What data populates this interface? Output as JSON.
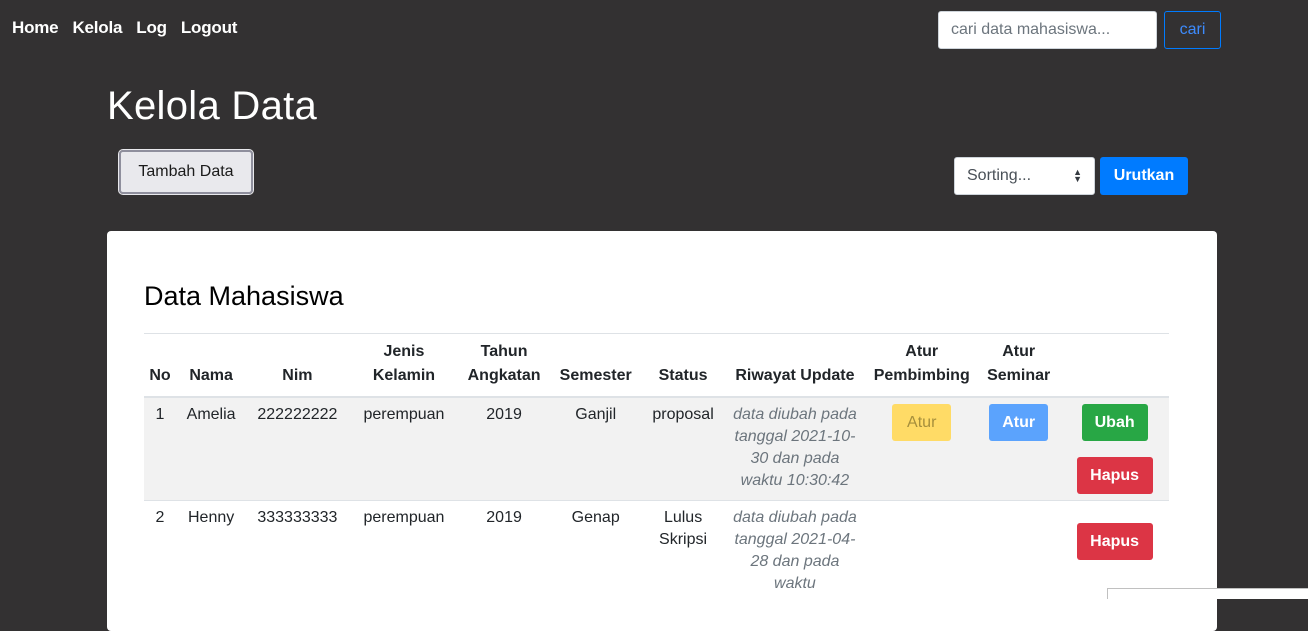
{
  "nav": {
    "items": [
      "Home",
      "Kelola",
      "Log",
      "Logout"
    ]
  },
  "search": {
    "placeholder": "cari data mahasiswa...",
    "button_label": "cari"
  },
  "page": {
    "title": "Kelola Data",
    "add_button": "Tambah Data"
  },
  "sort": {
    "selected": "Sorting...",
    "button_label": "Urutkan"
  },
  "card": {
    "title": "Data Mahasiswa"
  },
  "table": {
    "headers": [
      "No",
      "Nama",
      "Nim",
      "Jenis Kelamin",
      "Tahun Angkatan",
      "Semester",
      "Status",
      "Riwayat Update",
      "Atur Pembimbing",
      "Atur Seminar",
      ""
    ],
    "rows": [
      {
        "no": "1",
        "nama": "Amelia",
        "nim": "222222222",
        "jenis_kelamin": "perempuan",
        "tahun_angkatan": "2019",
        "semester": "Ganjil",
        "status": "proposal",
        "riwayat": "data diubah pada tanggal 2021-10-30 dan pada waktu 10:30:42",
        "atur_pembimbing": "Atur",
        "atur_seminar": "Atur",
        "ubah": "Ubah",
        "hapus": "Hapus"
      },
      {
        "no": "2",
        "nama": "Henny",
        "nim": "333333333",
        "jenis_kelamin": "perempuan",
        "tahun_angkatan": "2019",
        "semester": "Genap",
        "status": "Lulus Skripsi",
        "riwayat": "data diubah pada tanggal 2021-04-28 dan pada waktu",
        "hapus": "Hapus"
      }
    ]
  },
  "colors": {
    "background": "#333132",
    "primary": "#007bff",
    "success": "#28a745",
    "danger": "#dc3545",
    "warning": "#ffdb66"
  }
}
